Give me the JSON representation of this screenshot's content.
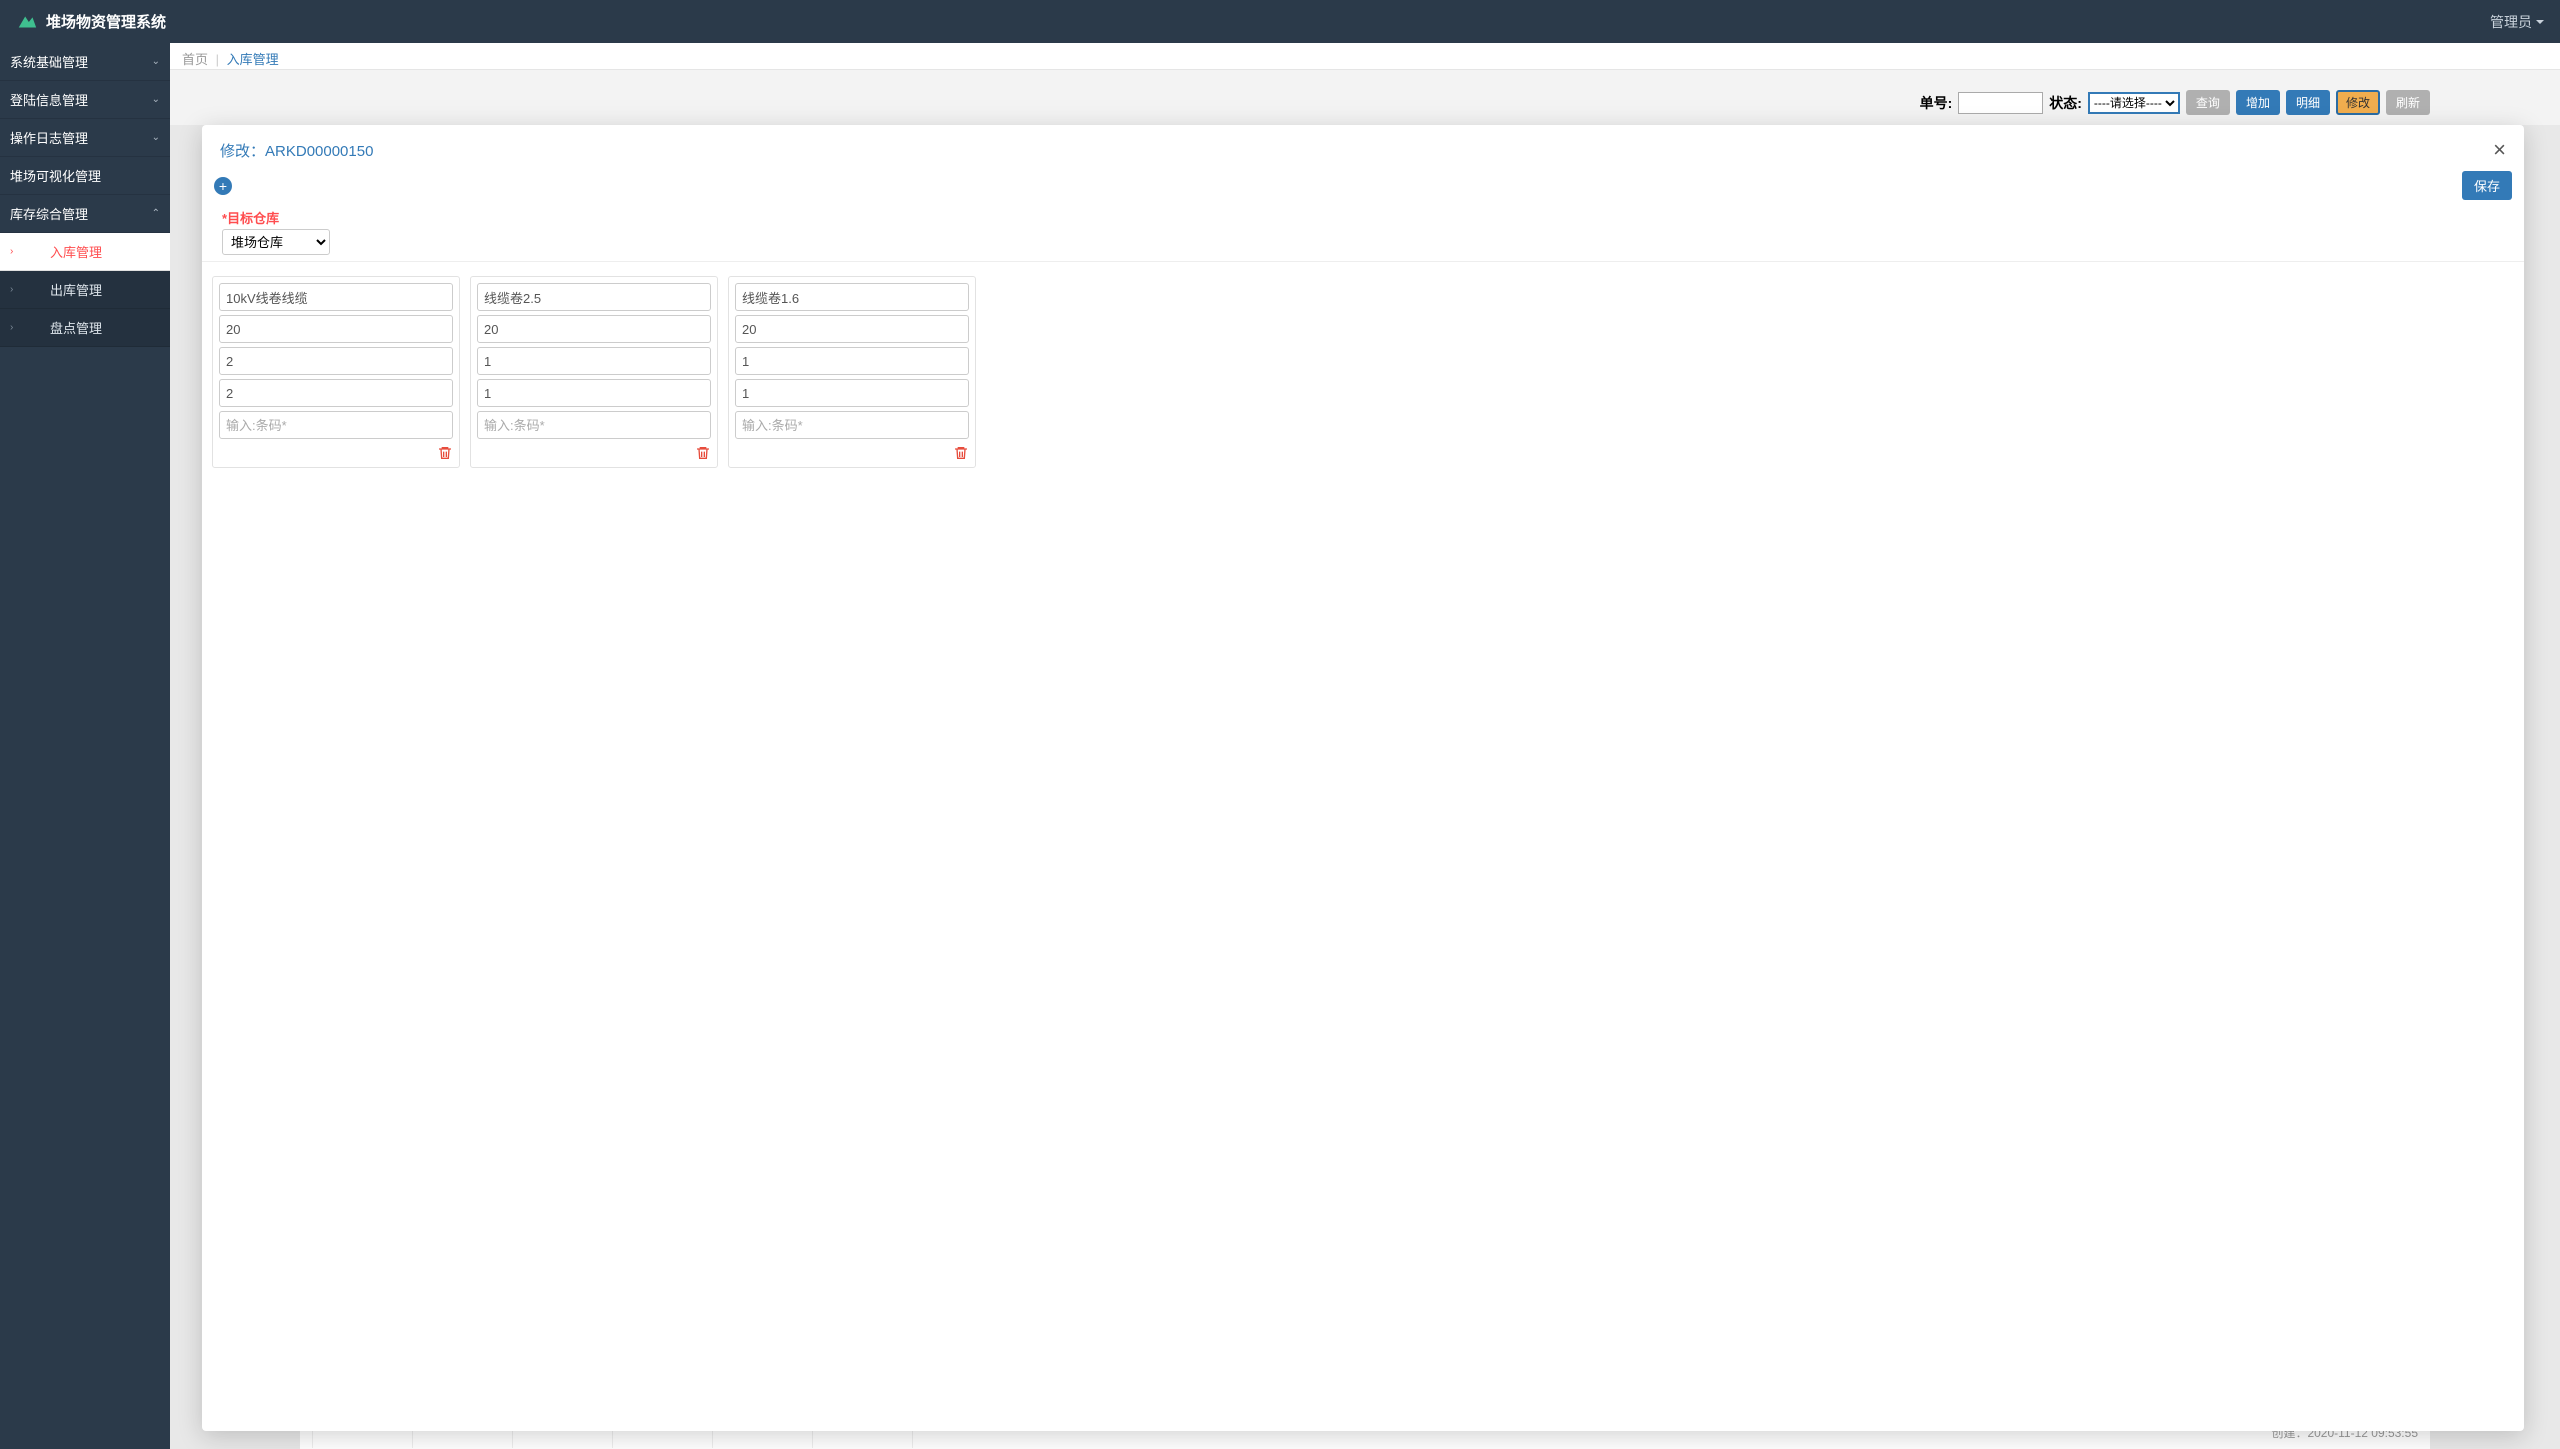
{
  "app": {
    "title": "堆场物资管理系统",
    "user_label": "管理员"
  },
  "sidebar": {
    "groups": [
      {
        "label": "系统基础管理",
        "expanded": false
      },
      {
        "label": "登陆信息管理",
        "expanded": false
      },
      {
        "label": "操作日志管理",
        "expanded": false
      },
      {
        "label": "堆场可视化管理",
        "expanded": false
      },
      {
        "label": "库存综合管理",
        "expanded": true
      }
    ],
    "sub_items": [
      {
        "label": "入库管理",
        "active": true
      },
      {
        "label": "出库管理",
        "active": false
      },
      {
        "label": "盘点管理",
        "active": false
      }
    ]
  },
  "breadcrumb": {
    "home": "首页",
    "current": "入库管理"
  },
  "filter": {
    "order_label": "单号:",
    "order_value": "",
    "status_label": "状态:",
    "status_placeholder": "----请选择----",
    "buttons": {
      "search": "查询",
      "add": "增加",
      "detail": "明细",
      "edit": "修改",
      "refresh": "刷新"
    }
  },
  "modal": {
    "title_prefix": "修改：",
    "order_id": "ARKD00000150",
    "save_label": "保存",
    "target_label": "目标仓库",
    "target_value": "堆场仓库",
    "barcode_placeholder": "输入:条码*",
    "items": [
      {
        "name": "10kV线卷线缆",
        "qty": "20",
        "f3": "2",
        "f4": "2"
      },
      {
        "name": "线缆卷2.5",
        "qty": "20",
        "f3": "1",
        "f4": "1"
      },
      {
        "name": "线缆卷1.6",
        "qty": "20",
        "f3": "1",
        "f4": "1"
      }
    ]
  },
  "page_footer": {
    "create_prefix": "创建：",
    "create_ts": "2020-11-12 09:53:55"
  }
}
